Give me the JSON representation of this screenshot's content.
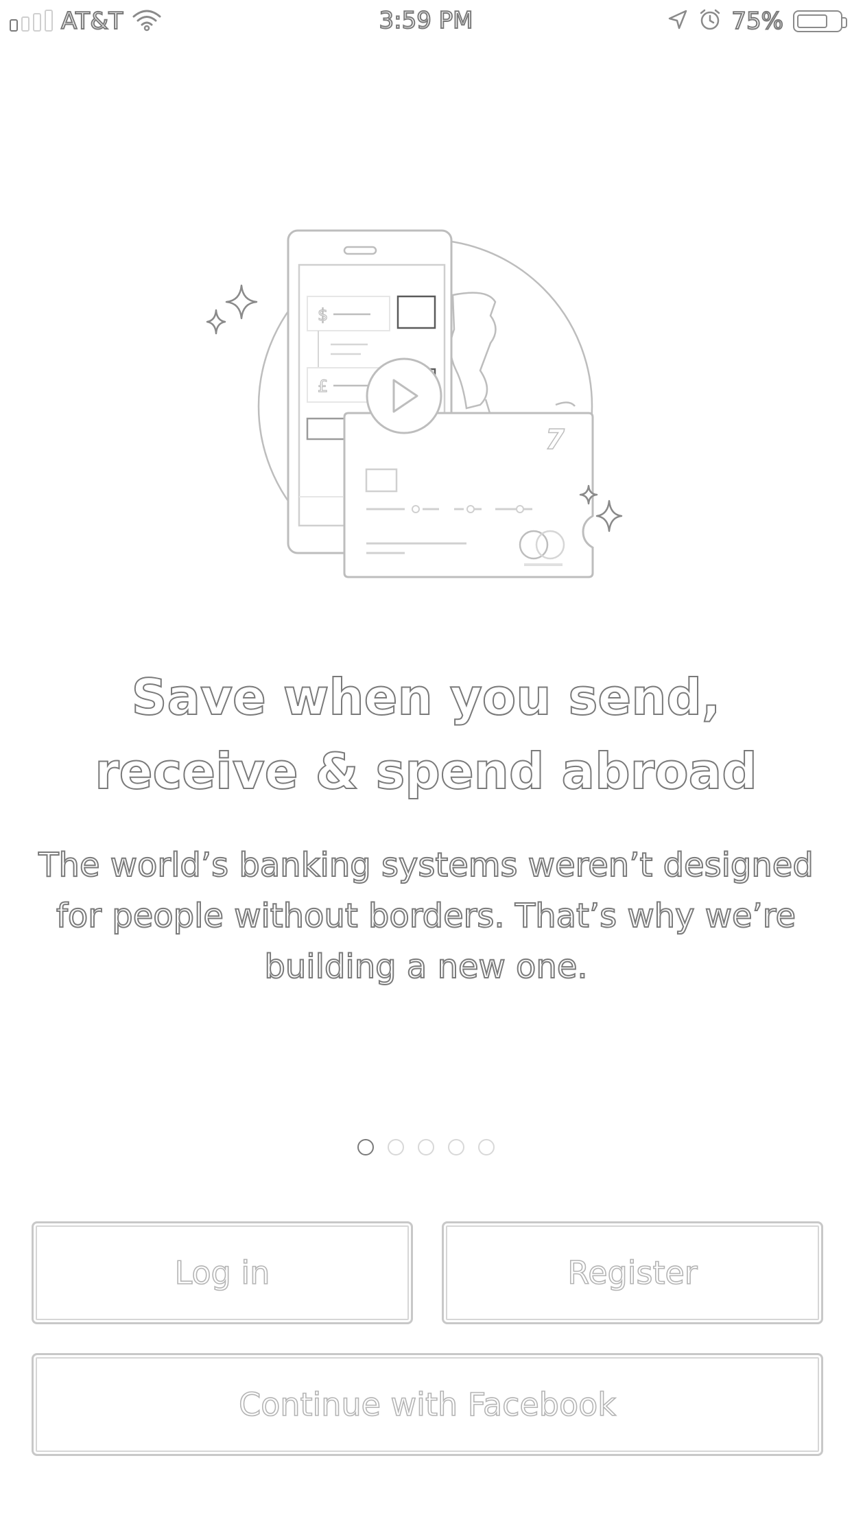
{
  "status_bar": {
    "carrier": "AT&T",
    "time": "3:59 PM",
    "battery_percent": "75%",
    "battery_level": 0.75,
    "signal_bars_filled": 1,
    "signal_bars_total": 4,
    "icons": [
      "signal-icon",
      "wifi-icon",
      "location-arrow-icon",
      "alarm-icon",
      "battery-icon"
    ]
  },
  "hero": {
    "illustration_icons": [
      "phone-icon",
      "globe-icon",
      "play-icon",
      "card-icon",
      "sparkle-icon"
    ],
    "illustration_glyphs": {
      "dollar": "$",
      "pound": "£",
      "card_logo": "7"
    }
  },
  "onboarding": {
    "headline": "Save when you send, receive & spend abroad",
    "body": "The world’s banking systems weren’t designed for people without borders. That’s why we’re building a new one.",
    "current_page": 1,
    "total_pages": 5
  },
  "actions": {
    "login_label": "Log in",
    "register_label": "Register",
    "facebook_label": "Continue with Facebook"
  },
  "colors": {
    "outline_dark": "#7a7a7a",
    "outline_light": "#b4b4b4",
    "background": "#ffffff"
  }
}
